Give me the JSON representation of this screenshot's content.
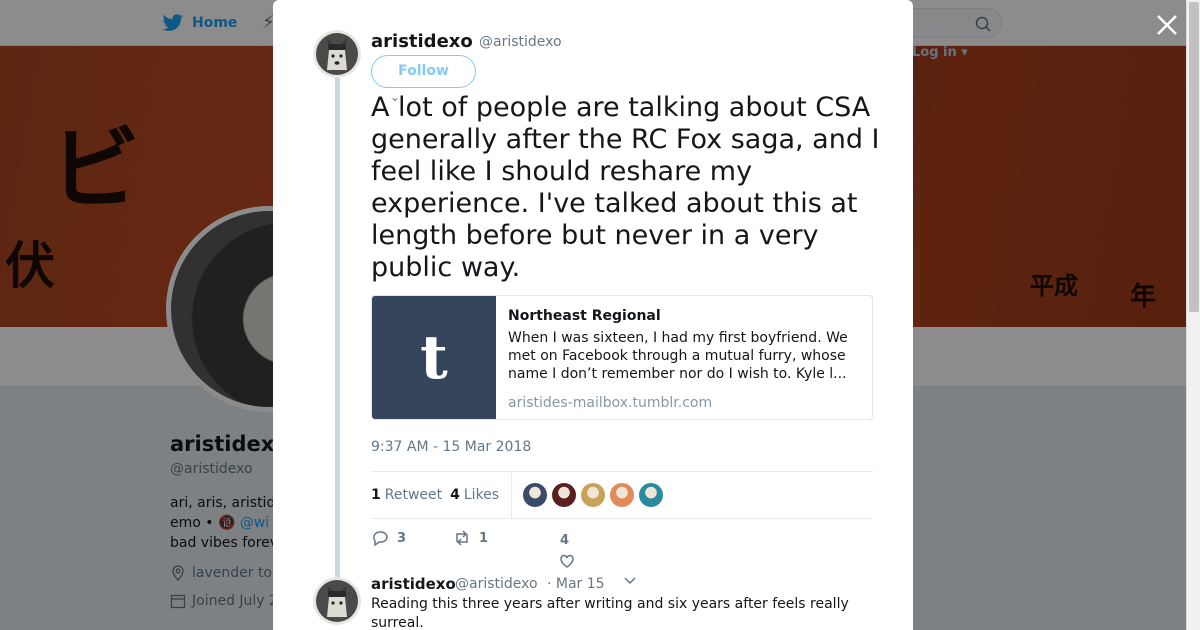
{
  "background": {
    "nav": {
      "home_label": "Home"
    },
    "search": {
      "placeholder": ""
    },
    "login_label": "Log in",
    "profile": {
      "name": "aristidex",
      "handle": "@aristidexo",
      "bio_line1": "ari, aris, aristid",
      "bio_line2_prefix": "emo • 🔞",
      "bio_mention": "@wi",
      "bio_line3": "bad vibes forev",
      "location": "lavender to",
      "joined": "Joined July 2"
    }
  },
  "modal": {
    "author": {
      "name": "aristidexo",
      "handle": "@aristidexo",
      "follow_label": "Follow"
    },
    "tweet_text": "A lot of people are talking about CSA generally after the RC Fox saga, and I feel like I should reshare my experience. I've talked about this at length before but never in a very public way.",
    "card": {
      "thumb_letter": "t",
      "title": "Northeast Regional",
      "description": "When I was sixteen, I had my first boyfriend. We met on Facebook through a mutual furry, whose name I don’t remember nor do I wish to. Kyle l...",
      "domain": "aristides-mailbox.tumblr.com"
    },
    "timestamp": "9:37 AM - 15 Mar 2018",
    "stats": {
      "retweets_count": "1",
      "retweets_label": "Retweet",
      "likes_count": "4",
      "likes_label": "Likes",
      "liker_colors": [
        "#3a4a6a",
        "#5b1f1f",
        "#c9a25a",
        "#e08a5a",
        "#2a8aa0"
      ]
    },
    "actions": {
      "replies": "3",
      "retweets": "1",
      "likes": "4"
    },
    "reply": {
      "name": "aristidexo",
      "handle": "@aristidexo",
      "date": "· Mar 15",
      "text": "Reading this three years after writing and six years after feels really surreal."
    }
  },
  "colors": {
    "accent": "#1da1f2",
    "text": "#14171a",
    "muted": "#657786",
    "tumblr": "#35465c"
  }
}
